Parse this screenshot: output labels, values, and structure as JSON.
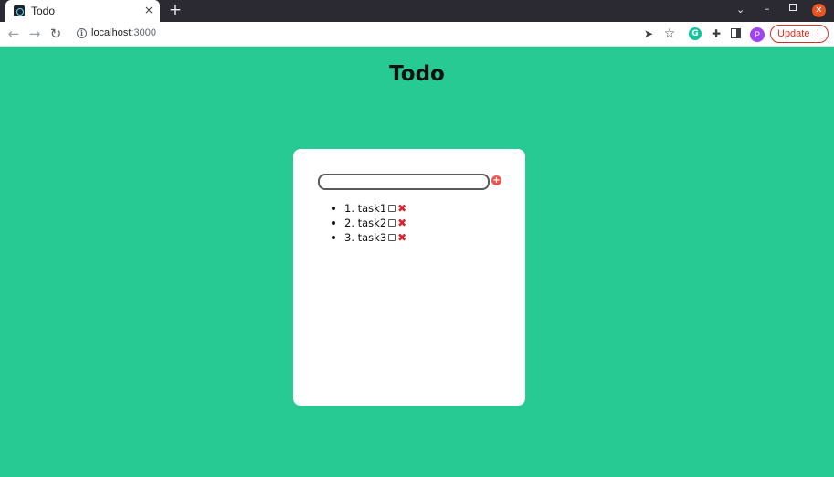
{
  "browser": {
    "tab_title": "Todo",
    "tab_close": "×",
    "new_tab": "+",
    "url_host": "localhost",
    "url_port": ":3000",
    "avatar_letter": "P",
    "update_label": "Update",
    "update_menu": "⋮",
    "icons": [
      "back-icon",
      "forward-icon",
      "reload-icon",
      "info-icon",
      "send-icon",
      "star-icon",
      "grammarly-icon",
      "puzzle-icon",
      "side-panel-icon"
    ]
  },
  "app": {
    "title": "Todo",
    "input_value": "",
    "add_button": "+",
    "tasks": [
      {
        "label": "1. task1",
        "checked": false
      },
      {
        "label": "2. task2",
        "checked": false
      },
      {
        "label": "3. task3",
        "checked": false
      }
    ],
    "delete_glyph": "✖"
  },
  "colors": {
    "page_background": "#26ca92",
    "card_background": "#ffffff",
    "delete_color": "#e0202a",
    "add_button_color": "#f0544f",
    "update_accent": "#d93025"
  }
}
